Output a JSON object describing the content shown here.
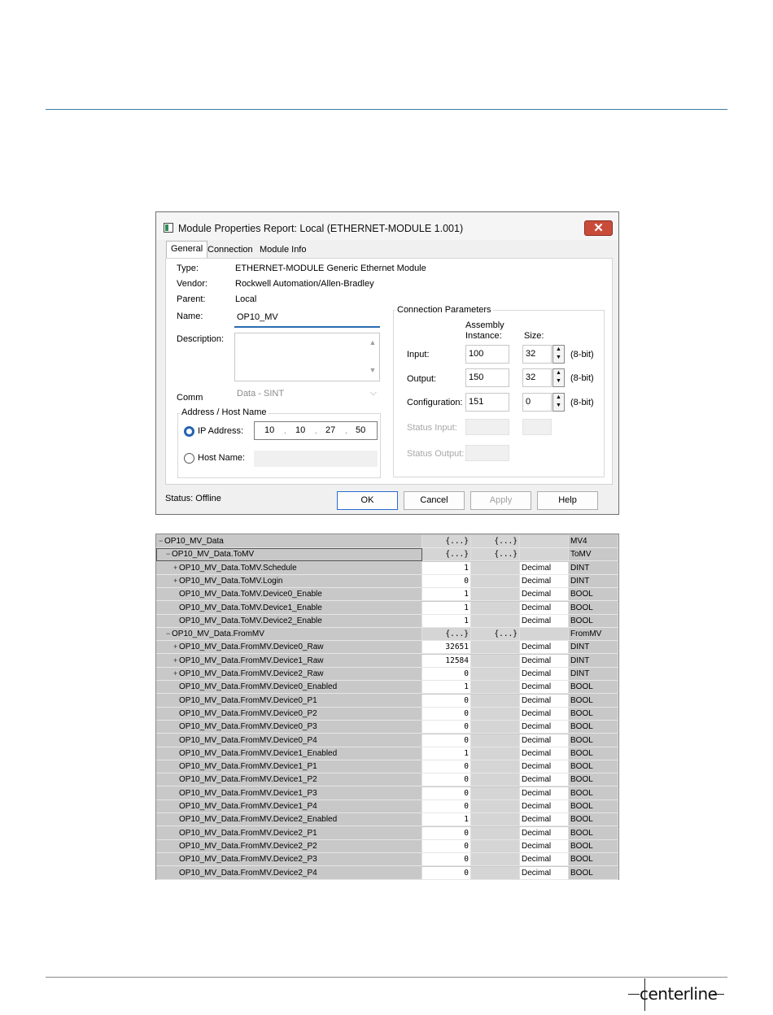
{
  "dialog": {
    "title": "Module Properties Report: Local (ETHERNET-MODULE 1.001)",
    "close_label": "✕",
    "tabs": [
      "General",
      "Connection",
      "Module Info"
    ],
    "type_label": "Type:",
    "type_value": "ETHERNET-MODULE Generic Ethernet Module",
    "vendor_label": "Vendor:",
    "vendor_value": "Rockwell Automation/Allen-Bradley",
    "parent_label": "Parent:",
    "parent_value": "Local",
    "name_label": "Name:",
    "name_value": "OP10_MV",
    "description_label": "Description:",
    "comm_label": "Comm",
    "comm_value": "Data - SINT",
    "address_group": "Address / Host Name",
    "ip_label": "IP Address:",
    "ip": [
      "10",
      "10",
      "27",
      "50"
    ],
    "host_label": "Host Name:",
    "conn_group": "Connection Parameters",
    "assembly_header_1": "Assembly",
    "assembly_header_2": "Instance:",
    "size_header": "Size:",
    "input_label": "Input:",
    "input_instance": "100",
    "input_size": "32",
    "output_label": "Output:",
    "output_instance": "150",
    "output_size": "32",
    "config_label": "Configuration:",
    "config_instance": "151",
    "config_size": "0",
    "unit_label": "(8-bit)",
    "status_input_label": "Status Input:",
    "status_output_label": "Status Output:",
    "status_text": "Status:  Offline",
    "buttons": {
      "ok": "OK",
      "cancel": "Cancel",
      "apply": "Apply",
      "help": "Help"
    }
  },
  "tags": [
    {
      "expand": "−",
      "name": "OP10_MV_Data",
      "value": "{...}",
      "force": "{...}",
      "style": "",
      "type": "MV4",
      "indent": 0,
      "grey": true
    },
    {
      "expand": "−",
      "name": "OP10_MV_Data.ToMV",
      "value": "{...}",
      "force": "{...}",
      "style": "",
      "type": "ToMV",
      "indent": 1,
      "grey": true,
      "selected": true
    },
    {
      "expand": "+",
      "name": "OP10_MV_Data.ToMV.Schedule",
      "value": "1",
      "force": "",
      "style": "Decimal",
      "type": "DINT",
      "indent": 2
    },
    {
      "expand": "+",
      "name": "OP10_MV_Data.ToMV.Login",
      "value": "0",
      "force": "",
      "style": "Decimal",
      "type": "DINT",
      "indent": 2
    },
    {
      "expand": "",
      "name": "OP10_MV_Data.ToMV.Device0_Enable",
      "value": "1",
      "force": "",
      "style": "Decimal",
      "type": "BOOL",
      "indent": 2
    },
    {
      "expand": "",
      "name": "OP10_MV_Data.ToMV.Device1_Enable",
      "value": "1",
      "force": "",
      "style": "Decimal",
      "type": "BOOL",
      "indent": 2
    },
    {
      "expand": "",
      "name": "OP10_MV_Data.ToMV.Device2_Enable",
      "value": "1",
      "force": "",
      "style": "Decimal",
      "type": "BOOL",
      "indent": 2
    },
    {
      "expand": "−",
      "name": "OP10_MV_Data.FromMV",
      "value": "{...}",
      "force": "{...}",
      "style": "",
      "type": "FromMV",
      "indent": 1,
      "grey": true
    },
    {
      "expand": "+",
      "name": "OP10_MV_Data.FromMV.Device0_Raw",
      "value": "32651",
      "force": "",
      "style": "Decimal",
      "type": "DINT",
      "indent": 2
    },
    {
      "expand": "+",
      "name": "OP10_MV_Data.FromMV.Device1_Raw",
      "value": "12584",
      "force": "",
      "style": "Decimal",
      "type": "DINT",
      "indent": 2
    },
    {
      "expand": "+",
      "name": "OP10_MV_Data.FromMV.Device2_Raw",
      "value": "0",
      "force": "",
      "style": "Decimal",
      "type": "DINT",
      "indent": 2
    },
    {
      "expand": "",
      "name": "OP10_MV_Data.FromMV.Device0_Enabled",
      "value": "1",
      "force": "",
      "style": "Decimal",
      "type": "BOOL",
      "indent": 2
    },
    {
      "expand": "",
      "name": "OP10_MV_Data.FromMV.Device0_P1",
      "value": "0",
      "force": "",
      "style": "Decimal",
      "type": "BOOL",
      "indent": 2
    },
    {
      "expand": "",
      "name": "OP10_MV_Data.FromMV.Device0_P2",
      "value": "0",
      "force": "",
      "style": "Decimal",
      "type": "BOOL",
      "indent": 2
    },
    {
      "expand": "",
      "name": "OP10_MV_Data.FromMV.Device0_P3",
      "value": "0",
      "force": "",
      "style": "Decimal",
      "type": "BOOL",
      "indent": 2
    },
    {
      "expand": "",
      "name": "OP10_MV_Data.FromMV.Device0_P4",
      "value": "0",
      "force": "",
      "style": "Decimal",
      "type": "BOOL",
      "indent": 2
    },
    {
      "expand": "",
      "name": "OP10_MV_Data.FromMV.Device1_Enabled",
      "value": "1",
      "force": "",
      "style": "Decimal",
      "type": "BOOL",
      "indent": 2
    },
    {
      "expand": "",
      "name": "OP10_MV_Data.FromMV.Device1_P1",
      "value": "0",
      "force": "",
      "style": "Decimal",
      "type": "BOOL",
      "indent": 2
    },
    {
      "expand": "",
      "name": "OP10_MV_Data.FromMV.Device1_P2",
      "value": "0",
      "force": "",
      "style": "Decimal",
      "type": "BOOL",
      "indent": 2
    },
    {
      "expand": "",
      "name": "OP10_MV_Data.FromMV.Device1_P3",
      "value": "0",
      "force": "",
      "style": "Decimal",
      "type": "BOOL",
      "indent": 2
    },
    {
      "expand": "",
      "name": "OP10_MV_Data.FromMV.Device1_P4",
      "value": "0",
      "force": "",
      "style": "Decimal",
      "type": "BOOL",
      "indent": 2
    },
    {
      "expand": "",
      "name": "OP10_MV_Data.FromMV.Device2_Enabled",
      "value": "1",
      "force": "",
      "style": "Decimal",
      "type": "BOOL",
      "indent": 2
    },
    {
      "expand": "",
      "name": "OP10_MV_Data.FromMV.Device2_P1",
      "value": "0",
      "force": "",
      "style": "Decimal",
      "type": "BOOL",
      "indent": 2
    },
    {
      "expand": "",
      "name": "OP10_MV_Data.FromMV.Device2_P2",
      "value": "0",
      "force": "",
      "style": "Decimal",
      "type": "BOOL",
      "indent": 2
    },
    {
      "expand": "",
      "name": "OP10_MV_Data.FromMV.Device2_P3",
      "value": "0",
      "force": "",
      "style": "Decimal",
      "type": "BOOL",
      "indent": 2
    },
    {
      "expand": "",
      "name": "OP10_MV_Data.FromMV.Device2_P4",
      "value": "0",
      "force": "",
      "style": "Decimal",
      "type": "BOOL",
      "indent": 2
    }
  ],
  "footer": {
    "logo": "centerline"
  },
  "colors": {
    "rule": "#3b7ea1",
    "close": "#c94c3b",
    "accent": "#2563b0"
  }
}
